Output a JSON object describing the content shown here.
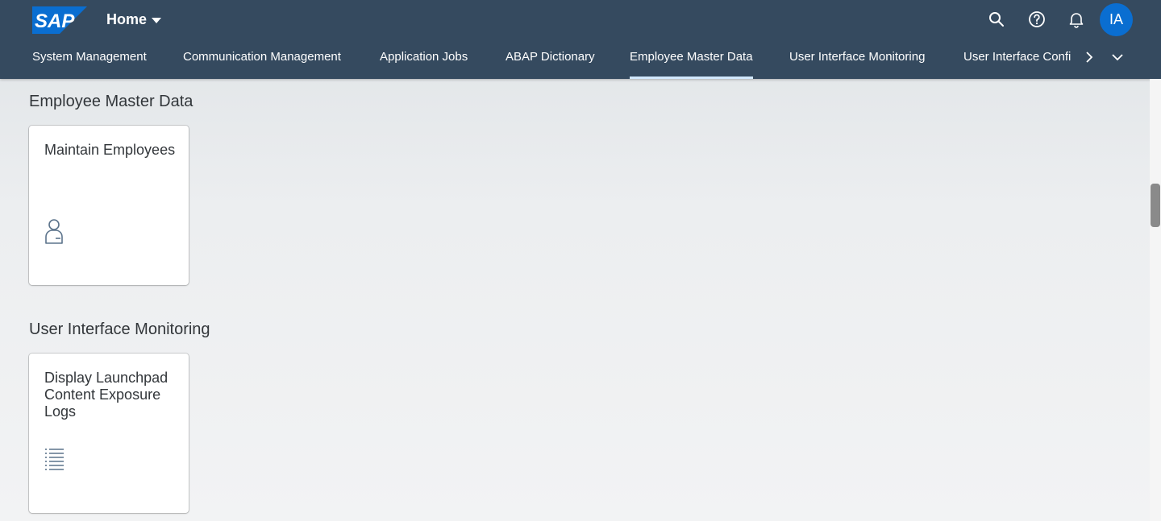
{
  "shell": {
    "logo_text": "SAP",
    "home_label": "Home",
    "icons": [
      "search-icon",
      "help-icon",
      "bell-icon"
    ],
    "avatar_initials": "IA",
    "colors": {
      "header_bg": "#354a5f",
      "avatar_bg": "#0a6ed1",
      "logo_blue": "#0a6ed1"
    }
  },
  "tabs": [
    {
      "label": "System Management"
    },
    {
      "label": "Communication Management"
    },
    {
      "label": "Application Jobs"
    },
    {
      "label": "ABAP Dictionary"
    },
    {
      "label": "Employee Master Data",
      "active": true
    },
    {
      "label": "User Interface Monitoring"
    },
    {
      "label": "User Interface Confi"
    }
  ],
  "sections": [
    {
      "title": "Employee Master Data",
      "tiles": [
        {
          "title": "Maintain Employees",
          "icon": "employee-icon"
        }
      ]
    },
    {
      "title": "User Interface Monitoring",
      "tiles": [
        {
          "title": "Display Launchpad Content Exposure Logs",
          "icon": "list-icon"
        }
      ]
    }
  ]
}
